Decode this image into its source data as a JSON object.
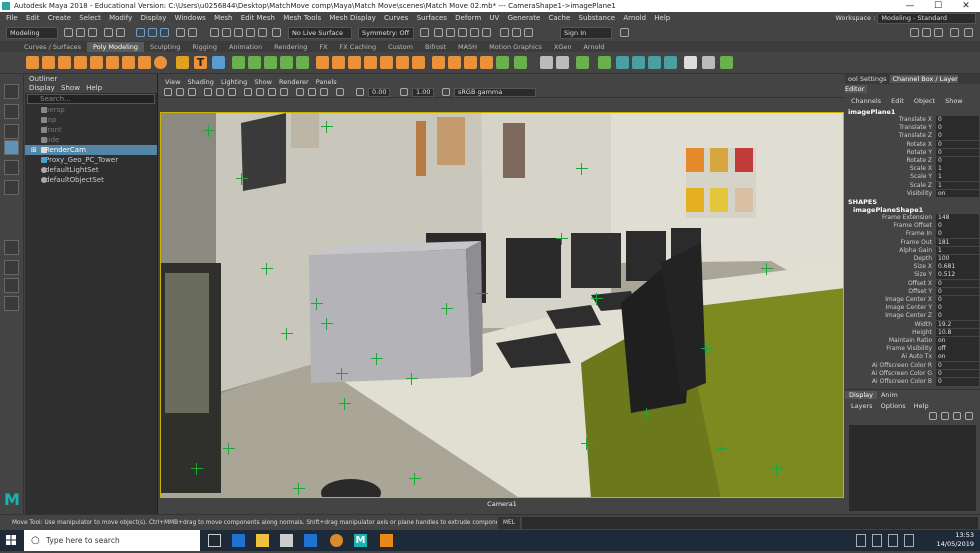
{
  "window": {
    "title": "Autodesk Maya 2018 - Educational Version: C:\\Users\\u0256844\\Desktop\\MatchMove comp\\Maya\\Match Move\\scenes\\Match Move 02.mb* --- CameraShape1->imagePlane1",
    "minimize": "—",
    "maximize": "☐",
    "close": "✕"
  },
  "menubar": [
    "File",
    "Edit",
    "Create",
    "Select",
    "Modify",
    "Display",
    "Windows",
    "Mesh",
    "Edit Mesh",
    "Mesh Tools",
    "Mesh Display",
    "Curves",
    "Surfaces",
    "Deform",
    "UV",
    "Generate",
    "Cache",
    "Substance",
    "Arnold",
    "Help"
  ],
  "workspace": {
    "label": "Workspace :",
    "value": "Modeling - Standard"
  },
  "statusline": {
    "mode": "Modeling",
    "live_surface": "No Live Surface",
    "symmetry": "Symmetry: Off",
    "sign_in": "Sign In"
  },
  "shelf_tabs": [
    "Curves / Surfaces",
    "Poly Modeling",
    "Sculpting",
    "Rigging",
    "Animation",
    "Rendering",
    "FX",
    "FX Caching",
    "Custom",
    "Bifrost",
    "MASH",
    "Motion Graphics",
    "XGen",
    "Arnold"
  ],
  "shelf_active": "Poly Modeling",
  "outliner": {
    "title": "Outliner",
    "menu": [
      "Display",
      "Show",
      "Help"
    ],
    "search_placeholder": "Search...",
    "items": [
      {
        "label": "persp",
        "dim": true
      },
      {
        "label": "top",
        "dim": true
      },
      {
        "label": "front",
        "dim": true
      },
      {
        "label": "side",
        "dim": true
      },
      {
        "label": "RenderCam",
        "dim": false,
        "selected": true
      },
      {
        "label": "Proxy_Geo_PC_Tower",
        "dim": false
      },
      {
        "label": "defaultLightSet",
        "dim": false
      },
      {
        "label": "defaultObjectSet",
        "dim": false
      }
    ]
  },
  "viewport": {
    "menu": [
      "View",
      "Shading",
      "Lighting",
      "Show",
      "Renderer",
      "Panels"
    ],
    "exposure": "0.00",
    "gamma": "1.00",
    "colorspace": "sRGB gamma",
    "camera_label": "Camera1"
  },
  "channel_box": {
    "tabs": [
      "ool Settings",
      "Channel Box / Layer Editor"
    ],
    "menu": [
      "Channels",
      "Edit",
      "Object",
      "Show"
    ],
    "node": "imagePlane1",
    "transform": [
      {
        "k": "Translate X",
        "v": "0"
      },
      {
        "k": "Translate Y",
        "v": "0"
      },
      {
        "k": "Translate Z",
        "v": "0"
      },
      {
        "k": "Rotate X",
        "v": "0"
      },
      {
        "k": "Rotate Y",
        "v": "0"
      },
      {
        "k": "Rotate Z",
        "v": "0"
      },
      {
        "k": "Scale X",
        "v": "1"
      },
      {
        "k": "Scale Y",
        "v": "1"
      },
      {
        "k": "Scale Z",
        "v": "1"
      },
      {
        "k": "Visibility",
        "v": "on"
      }
    ],
    "shapes_label": "SHAPES",
    "shape_node": "imagePlaneShape1",
    "shape": [
      {
        "k": "Frame Extension",
        "v": "148"
      },
      {
        "k": "Frame Offset",
        "v": "0"
      },
      {
        "k": "Frame In",
        "v": "0"
      },
      {
        "k": "Frame Out",
        "v": "181"
      },
      {
        "k": "Alpha Gain",
        "v": "1"
      },
      {
        "k": "Depth",
        "v": "100"
      },
      {
        "k": "Size X",
        "v": "0.681"
      },
      {
        "k": "Size Y",
        "v": "0.512"
      },
      {
        "k": "Offset X",
        "v": "0"
      },
      {
        "k": "Offset Y",
        "v": "0"
      },
      {
        "k": "Image Center X",
        "v": "0"
      },
      {
        "k": "Image Center Y",
        "v": "0"
      },
      {
        "k": "Image Center Z",
        "v": "0"
      },
      {
        "k": "Width",
        "v": "19.2"
      },
      {
        "k": "Height",
        "v": "10.8"
      },
      {
        "k": "Maintain Ratio",
        "v": "on"
      },
      {
        "k": "Frame Visibility",
        "v": "off"
      },
      {
        "k": "Ai Auto Tx",
        "v": "on"
      },
      {
        "k": "Ai Offscreen Color R",
        "v": "0"
      },
      {
        "k": "Ai Offscreen Color G",
        "v": "0"
      },
      {
        "k": "Ai Offscreen Color B",
        "v": "0"
      }
    ]
  },
  "layer_editor": {
    "tabs": [
      "Display",
      "Anim"
    ],
    "menu": [
      "Layers",
      "Options",
      "Help"
    ]
  },
  "helpline": {
    "text": "Move Tool: Use manipulator to move object(s). Ctrl+MMB+drag to move components along normals. Shift+drag manipulator axis or plane handles to extrude components or clone objects. Ctrl+Shift+LMB+drag to",
    "mel": "MEL"
  },
  "taskbar": {
    "search_placeholder": "Type here to search",
    "time": "13:53",
    "date": "14/05/2019"
  }
}
